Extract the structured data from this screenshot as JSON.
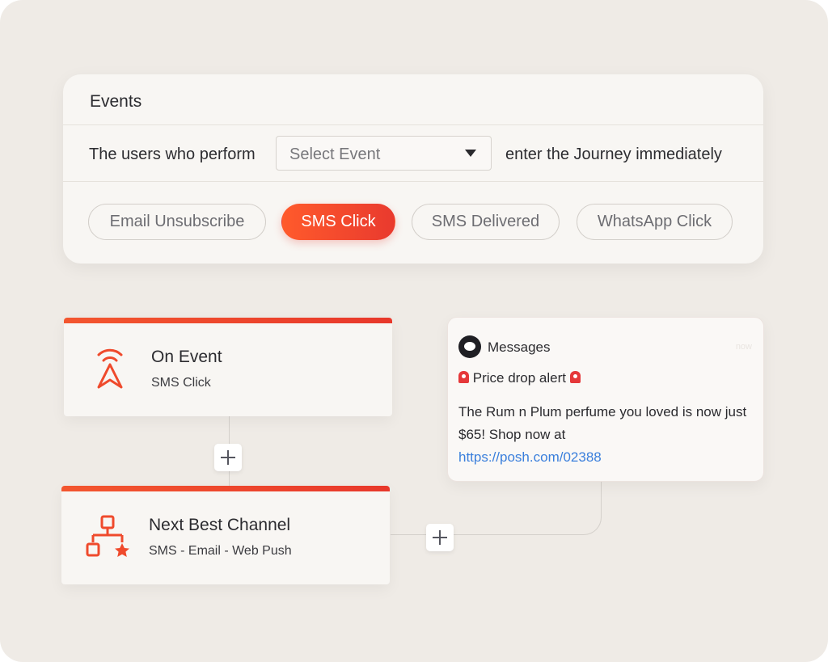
{
  "events": {
    "title": "Events",
    "rule_prefix": "The users who perform",
    "select_placeholder": "Select Event",
    "rule_suffix": "enter the Journey immediately",
    "chips": [
      {
        "label": "Email Unsubscribe",
        "selected": false
      },
      {
        "label": "SMS Click",
        "selected": true
      },
      {
        "label": "SMS Delivered",
        "selected": false
      },
      {
        "label": "WhatsApp Click",
        "selected": false
      }
    ]
  },
  "flow": {
    "trigger": {
      "title": "On Event",
      "subtitle": "SMS Click",
      "icon": "broadcast-arrow-icon"
    },
    "channel": {
      "title": "Next Best Channel",
      "subtitle": "SMS - Email - Web Push",
      "icon": "org-chart-star-icon"
    },
    "add_icon": "plus-icon"
  },
  "message": {
    "app": "Messages",
    "time": "now",
    "headline": "Price drop alert",
    "body": "The Rum n Plum perfume you loved is now just $65! Shop now at",
    "link": "https://posh.com/02388"
  },
  "colors": {
    "accent_start": "#ff5a2c",
    "accent_end": "#e93a2e",
    "background": "#efebe6",
    "link": "#3a7fdc"
  }
}
